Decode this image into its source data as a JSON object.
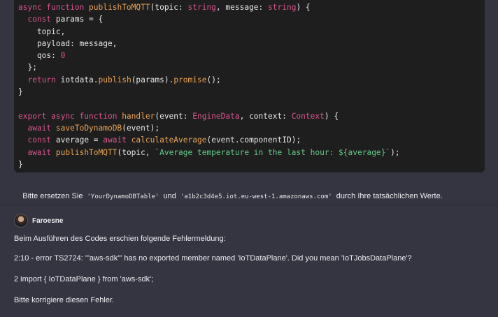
{
  "code": {
    "lines": [
      [
        {
          "c": "kw",
          "t": "async function "
        },
        {
          "c": "fn",
          "t": "publishToMQTT"
        },
        {
          "c": "pl",
          "t": "(topic: "
        },
        {
          "c": "ty",
          "t": "string"
        },
        {
          "c": "pl",
          "t": ", message: "
        },
        {
          "c": "ty",
          "t": "string"
        },
        {
          "c": "pl",
          "t": ") {"
        }
      ],
      [
        {
          "c": "pl",
          "t": "  "
        },
        {
          "c": "kw",
          "t": "const "
        },
        {
          "c": "pl",
          "t": "params = {"
        }
      ],
      [
        {
          "c": "pl",
          "t": "    topic,"
        }
      ],
      [
        {
          "c": "pl",
          "t": "    payload: message,"
        }
      ],
      [
        {
          "c": "pl",
          "t": "    qos: "
        },
        {
          "c": "nu",
          "t": "0"
        }
      ],
      [
        {
          "c": "pl",
          "t": "  };"
        }
      ],
      [
        {
          "c": "pl",
          "t": "  "
        },
        {
          "c": "kw",
          "t": "return "
        },
        {
          "c": "pl",
          "t": "iotdata."
        },
        {
          "c": "fn",
          "t": "publish"
        },
        {
          "c": "pl",
          "t": "(params)."
        },
        {
          "c": "fn",
          "t": "promise"
        },
        {
          "c": "pl",
          "t": "();"
        }
      ],
      [
        {
          "c": "pl",
          "t": "}"
        }
      ],
      [
        {
          "c": "pl",
          "t": ""
        }
      ],
      [
        {
          "c": "kw",
          "t": "export async function "
        },
        {
          "c": "fn",
          "t": "handler"
        },
        {
          "c": "pl",
          "t": "(event: "
        },
        {
          "c": "ty",
          "t": "EngineData"
        },
        {
          "c": "pl",
          "t": ", context: "
        },
        {
          "c": "ty",
          "t": "Context"
        },
        {
          "c": "pl",
          "t": ") {"
        }
      ],
      [
        {
          "c": "pl",
          "t": "  "
        },
        {
          "c": "kw",
          "t": "await "
        },
        {
          "c": "fn",
          "t": "saveToDynamoDB"
        },
        {
          "c": "pl",
          "t": "(event);"
        }
      ],
      [
        {
          "c": "pl",
          "t": "  "
        },
        {
          "c": "kw",
          "t": "const "
        },
        {
          "c": "pl",
          "t": "average = "
        },
        {
          "c": "kw",
          "t": "await "
        },
        {
          "c": "fn",
          "t": "calculateAverage"
        },
        {
          "c": "pl",
          "t": "(event.componentID);"
        }
      ],
      [
        {
          "c": "pl",
          "t": "  "
        },
        {
          "c": "kw",
          "t": "await "
        },
        {
          "c": "fn",
          "t": "publishToMQTT"
        },
        {
          "c": "pl",
          "t": "(topic, "
        },
        {
          "c": "st",
          "t": "`Average temperature in the last hour: ${average}`"
        },
        {
          "c": "pl",
          "t": ");"
        }
      ],
      [
        {
          "c": "pl",
          "t": "}"
        }
      ]
    ]
  },
  "assistant_note": {
    "before": "Bitte ersetzen Sie ",
    "code1": "'YourDynamoDBTable'",
    "middle": " und ",
    "code2": "'a1b2c3d4e5.iot.eu-west-1.amazonaws.com'",
    "after": " durch Ihre tatsächlichen Werte."
  },
  "user": {
    "name": "Faroesne",
    "message_lines": [
      "Beim Ausführen des Codes erschien folgende Fehlermeldung:",
      "2:10 - error TS2724: '\"aws-sdk\"' has no exported member named 'IoTDataPlane'. Did you mean 'IoTJobsDataPlane'?",
      "2 import { IoTDataPlane } from 'aws-sdk';",
      "Bitte korrigiere diesen Fehler."
    ]
  },
  "colors": {
    "background": "#343541",
    "code_background": "#1e1e1e",
    "keyword": "#d8548e",
    "function": "#e9a458",
    "string": "#65c987"
  }
}
